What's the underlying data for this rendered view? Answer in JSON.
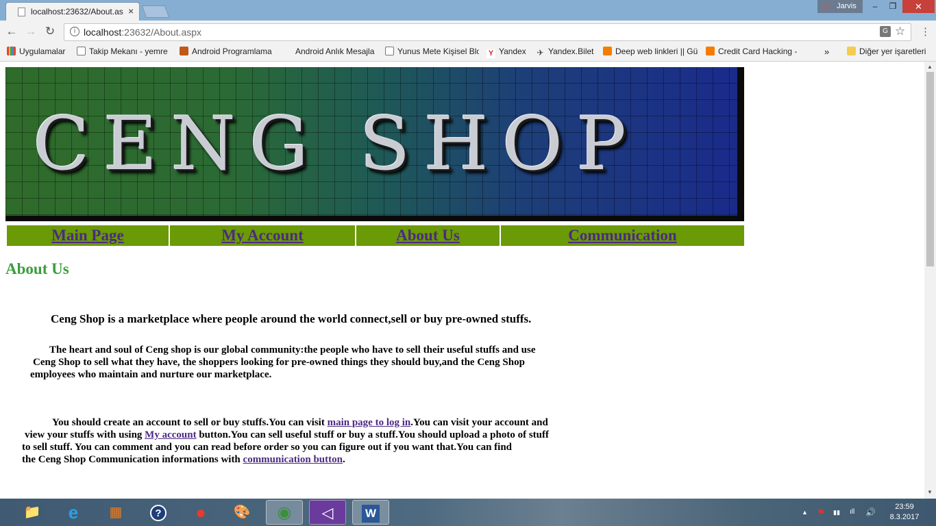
{
  "browser": {
    "tab": {
      "title": "localhost:23632/About.as",
      "close": "×"
    },
    "user": {
      "name": "Jarvis"
    },
    "window_buttons": {
      "minimize": "–",
      "restore": "❐",
      "close": "✕"
    },
    "nav": {
      "back": "←",
      "forward": "→",
      "reload": "↻"
    },
    "address": {
      "host": "localhost",
      "rest": ":23632/About.aspx"
    },
    "menu": "⋮",
    "bookmarks": [
      {
        "label": "Uygulamalar",
        "icon": "apps-grid-icon",
        "color": "#e94235"
      },
      {
        "label": "Takip Mekanı - yemre",
        "icon": "page-icon",
        "color": "#ffffff"
      },
      {
        "label": "Android Programlama",
        "icon": "bookmark-icon",
        "color": "#c2571a"
      },
      {
        "label": "Android Anlık Mesajla",
        "icon": "blank-icon",
        "color": "#f2f2f2"
      },
      {
        "label": "Yunus Mete Kişisel Blo",
        "icon": "page-icon",
        "color": "#ffffff"
      },
      {
        "label": "Yandex",
        "icon": "yandex-icon",
        "color": "#d32f2f"
      },
      {
        "label": "Yandex.Bilet",
        "icon": "plane-icon",
        "color": "#444444"
      },
      {
        "label": "Deep web linkleri || Gü",
        "icon": "blogger-icon",
        "color": "#f57c00"
      },
      {
        "label": "Credit Card Hacking -",
        "icon": "blogger-icon",
        "color": "#f57c00"
      }
    ],
    "bookmarks_overflow": "»",
    "other_bookmarks": "Diğer yer işaretleri"
  },
  "page": {
    "banner_title": "CENG SHOP",
    "menu": [
      {
        "label": "Main Page"
      },
      {
        "label": "My Account"
      },
      {
        "label": "About Us"
      },
      {
        "label": "Communication"
      }
    ],
    "heading": "About Us",
    "intro": "Ceng Shop is a marketplace where people around the world connect,sell or buy pre-owned stuffs.",
    "para2": {
      "line1": "The heart and soul of Ceng shop is our global community:the people who have to sell their useful stuffs and use",
      "line2": "Ceng Shop to sell what they have, the shoppers looking for pre-owned things they should buy,and the Ceng Shop",
      "line3": "employees who maintain and nurture our marketplace."
    },
    "para3": {
      "l1_pre": "You should create an account to sell or buy stuffs.You can visit ",
      "l1_link": "main page to log in",
      "l1_post": ".You can visit your account and",
      "l2_pre": "view your stuffs with using ",
      "l2_link": "My account",
      "l2_post": " button.You can sell useful stuff or buy a stuff.You should upload a photo of stuff",
      "line3": "to sell stuff. You can comment and you can read before order so you can figure out if you want that.You can find",
      "l4_pre": "the Ceng Shop Communication informations with ",
      "l4_link": "communication button",
      "l4_post": "."
    }
  },
  "taskbar": {
    "apps": [
      {
        "name": "file-explorer-icon",
        "glyph": "📁"
      },
      {
        "name": "internet-explorer-icon",
        "glyph": "e"
      },
      {
        "name": "office-icon",
        "glyph": "▦"
      },
      {
        "name": "help-icon",
        "glyph": "?"
      },
      {
        "name": "app-red-icon",
        "glyph": "●"
      },
      {
        "name": "paint-icon",
        "glyph": "🎨"
      },
      {
        "name": "chrome-icon",
        "glyph": "◉"
      },
      {
        "name": "visual-studio-icon",
        "glyph": "◁"
      },
      {
        "name": "word-icon",
        "glyph": "W"
      }
    ],
    "tray": {
      "arrow": "▲",
      "flag": "⚑",
      "network": "▮▮",
      "signal": "ıll",
      "volume": "🔊"
    },
    "time": "23:59",
    "date": "8.3.2017"
  }
}
